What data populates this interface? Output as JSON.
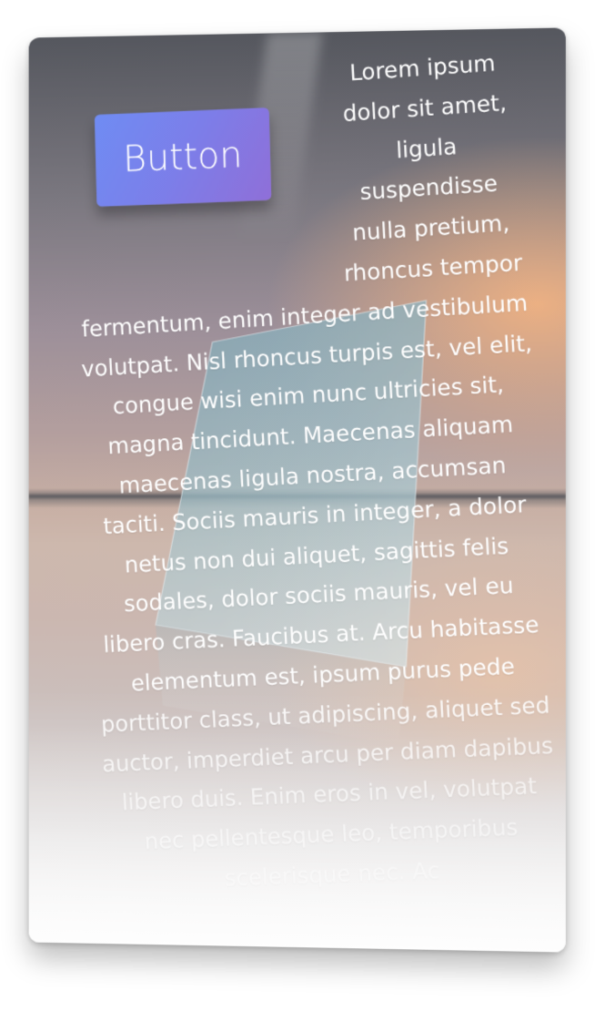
{
  "button": {
    "label": "Button"
  },
  "body_text": "Lorem ipsum dolor sit amet, ligula suspendisse nulla pretium, rhoncus tempor fermentum, enim integer ad vestibulum volutpat. Nisl rhoncus turpis est, vel elit, congue wisi enim nunc ultricies sit, magna tincidunt. Maecenas aliquam maecenas ligula nostra, accumsan taciti. Sociis mauris in integer, a dolor netus non dui aliquet, sagittis felis sodales, dolor sociis mauris, vel eu libero cras. Faucibus at. Arcu habitasse elementum est, ipsum purus pede porttitor class, ut adipiscing, aliquet sed auctor, imperdiet arcu per diam dapibus libero duis. Enim eros in vel, volutpat nec pellentesque leo, temporibus scelerisque nec. Ac",
  "colors": {
    "button_start": "#6f8cf3",
    "button_end": "#8f6fd8",
    "text": "#ffffff"
  }
}
